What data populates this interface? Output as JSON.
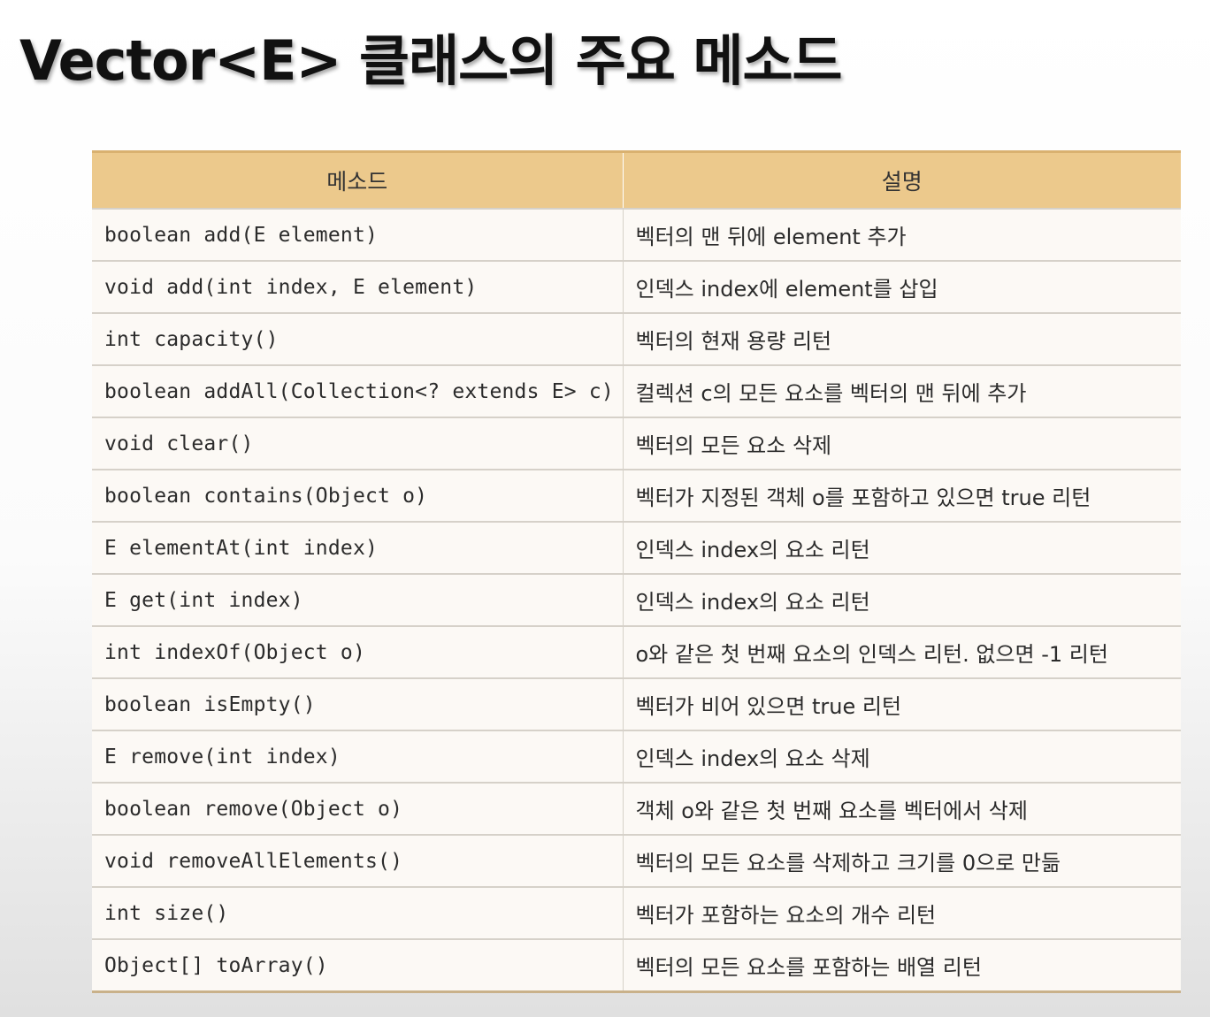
{
  "title": "Vector<E> 클래스의 주요 메소드",
  "table": {
    "headers": [
      "메소드",
      "설명"
    ],
    "rows": [
      {
        "method": "boolean add(E element)",
        "desc": "벡터의 맨 뒤에 element 추가"
      },
      {
        "method": "void add(int index, E element)",
        "desc": "인덱스 index에 element를 삽입"
      },
      {
        "method": "int capacity()",
        "desc": "벡터의 현재 용량 리턴"
      },
      {
        "method": "boolean addAll(Collection<? extends E> c)",
        "desc": "컬렉션 c의 모든 요소를 벡터의 맨 뒤에 추가"
      },
      {
        "method": "void clear()",
        "desc": "벡터의 모든 요소 삭제"
      },
      {
        "method": "boolean contains(Object o)",
        "desc": "벡터가 지정된 객체 o를 포함하고 있으면 true 리턴"
      },
      {
        "method": "E elementAt(int index)",
        "desc": "인덱스 index의 요소 리턴"
      },
      {
        "method": "E get(int index)",
        "desc": "인덱스 index의 요소 리턴"
      },
      {
        "method": "int indexOf(Object o)",
        "desc": "o와 같은 첫 번째 요소의 인덱스 리턴. 없으면 -1 리턴"
      },
      {
        "method": "boolean isEmpty()",
        "desc": "벡터가 비어 있으면 true 리턴"
      },
      {
        "method": "E remove(int index)",
        "desc": "인덱스 index의 요소 삭제"
      },
      {
        "method": "boolean remove(Object o)",
        "desc": "객체 o와 같은 첫 번째 요소를 벡터에서 삭제"
      },
      {
        "method": "void removeAllElements()",
        "desc": "벡터의 모든 요소를 삭제하고 크기를 0으로 만듦"
      },
      {
        "method": "int size()",
        "desc": "벡터가 포함하는 요소의 개수 리턴"
      },
      {
        "method": "Object[] toArray()",
        "desc": "벡터의 모든 요소를 포함하는 배열 리턴"
      }
    ]
  }
}
